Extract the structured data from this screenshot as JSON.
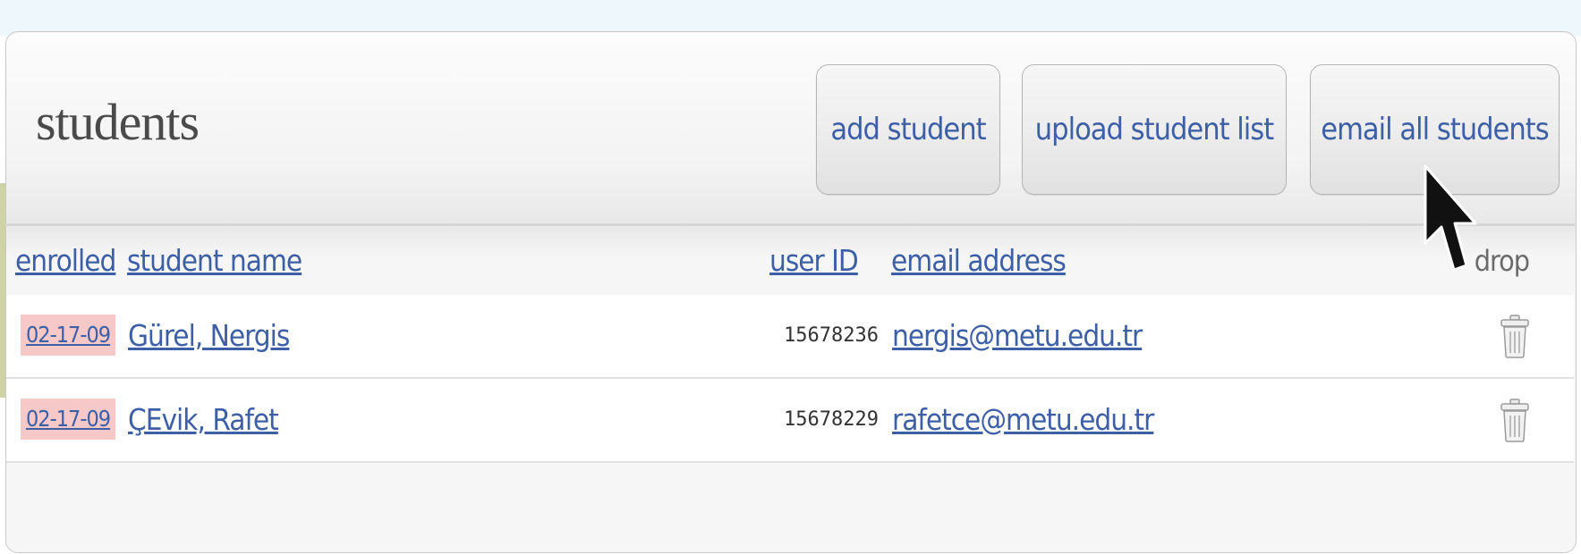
{
  "panel": {
    "title": "students"
  },
  "toolbar": {
    "add_label": "add student",
    "upload_label": "upload student list",
    "email_all_label": "email all students"
  },
  "table": {
    "headers": {
      "enrolled": "enrolled",
      "student_name": "student name",
      "user_id": "user ID",
      "email_address": "email address",
      "drop": "drop"
    },
    "rows": [
      {
        "enrolled": "02-17-09",
        "name": "Gürel, Nergis",
        "user_id": "15678236",
        "email": "nergis@metu.edu.tr"
      },
      {
        "enrolled": "02-17-09",
        "name": "ÇEvik, Rafet",
        "user_id": "15678229",
        "email": "rafetce@metu.edu.tr"
      }
    ]
  },
  "icons": {
    "row_drop": "trash-icon",
    "pointer": "mouse-cursor-icon"
  },
  "colors": {
    "link": "#3c5fa6",
    "enrolled_highlight": "#f6c8c8",
    "top_band": "#eef7fc"
  }
}
